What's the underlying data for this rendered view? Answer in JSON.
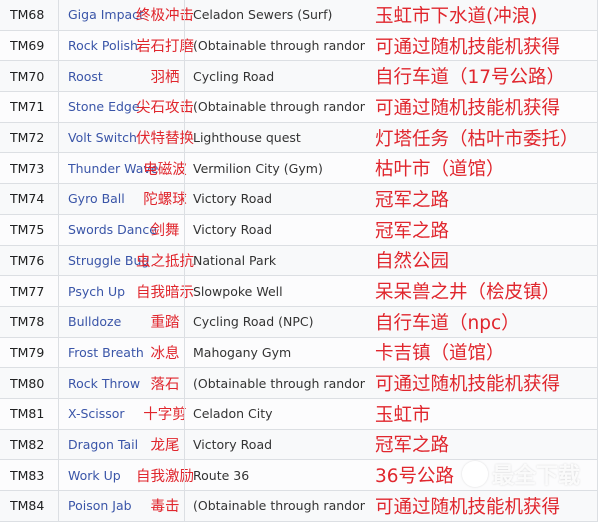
{
  "rows": [
    {
      "tm": "TM68",
      "move": "Giga Impact",
      "move_cn": "终极冲击",
      "location": "Celadon Sewers (Surf)",
      "location_cn": "玉虹市下水道(冲浪)"
    },
    {
      "tm": "TM69",
      "move": "Rock Polish",
      "move_cn": "岩石打磨",
      "location": "(Obtainable through randomized TM)",
      "location_cn": "可通过随机技能机获得"
    },
    {
      "tm": "TM70",
      "move": "Roost",
      "move_cn": "羽栖",
      "location": "Cycling Road",
      "location_cn": "自行车道（17号公路）"
    },
    {
      "tm": "TM71",
      "move": "Stone Edge",
      "move_cn": "尖石攻击",
      "location": "(Obtainable through randomized TM)",
      "location_cn": "可通过随机技能机获得"
    },
    {
      "tm": "TM72",
      "move": "Volt Switch",
      "move_cn": "伏特替换",
      "location": "Lighthouse quest",
      "location_cn": "灯塔任务（枯叶市委托）"
    },
    {
      "tm": "TM73",
      "move": "Thunder Wave",
      "move_cn": "电磁波",
      "location": "Vermilion City (Gym)",
      "location_cn": "枯叶市（道馆）"
    },
    {
      "tm": "TM74",
      "move": "Gyro Ball",
      "move_cn": "陀螺球",
      "location": "Victory Road",
      "location_cn": "冠军之路"
    },
    {
      "tm": "TM75",
      "move": "Swords Dance",
      "move_cn": "剑舞",
      "location": "Victory Road",
      "location_cn": "冠军之路"
    },
    {
      "tm": "TM76",
      "move": "Struggle Bug",
      "move_cn": "虫之抵抗",
      "location": "National Park",
      "location_cn": "自然公园"
    },
    {
      "tm": "TM77",
      "move": "Psych Up",
      "move_cn": "自我暗示",
      "location": "Slowpoke Well",
      "location_cn": "呆呆兽之井（桧皮镇）"
    },
    {
      "tm": "TM78",
      "move": "Bulldoze",
      "move_cn": "重踏",
      "location": "Cycling Road (NPC)",
      "location_cn": "自行车道（npc）"
    },
    {
      "tm": "TM79",
      "move": "Frost Breath",
      "move_cn": "冰息",
      "location": "Mahogany Gym",
      "location_cn": "卡吉镇（道馆）"
    },
    {
      "tm": "TM80",
      "move": "Rock Throw",
      "move_cn": "落石",
      "location": "(Obtainable through randomized TM)",
      "location_cn": "可通过随机技能机获得"
    },
    {
      "tm": "TM81",
      "move": "X-Scissor",
      "move_cn": "十字剪",
      "location": "Celadon City",
      "location_cn": "玉虹市"
    },
    {
      "tm": "TM82",
      "move": "Dragon Tail",
      "move_cn": "龙尾",
      "location": "Victory Road",
      "location_cn": "冠军之路"
    },
    {
      "tm": "TM83",
      "move": "Work Up",
      "move_cn": "自我激励",
      "location": "Route 36",
      "location_cn": "36号公路"
    },
    {
      "tm": "TM84",
      "move": "Poison Jab",
      "move_cn": "毒击",
      "location": "(Obtainable through randomized TM)",
      "location_cn": "可通过随机技能机获得"
    }
  ],
  "watermark": "最全下载",
  "colors": {
    "link": "#3a55a8",
    "annotation": "#e0262d",
    "border": "#dcdfe3"
  }
}
